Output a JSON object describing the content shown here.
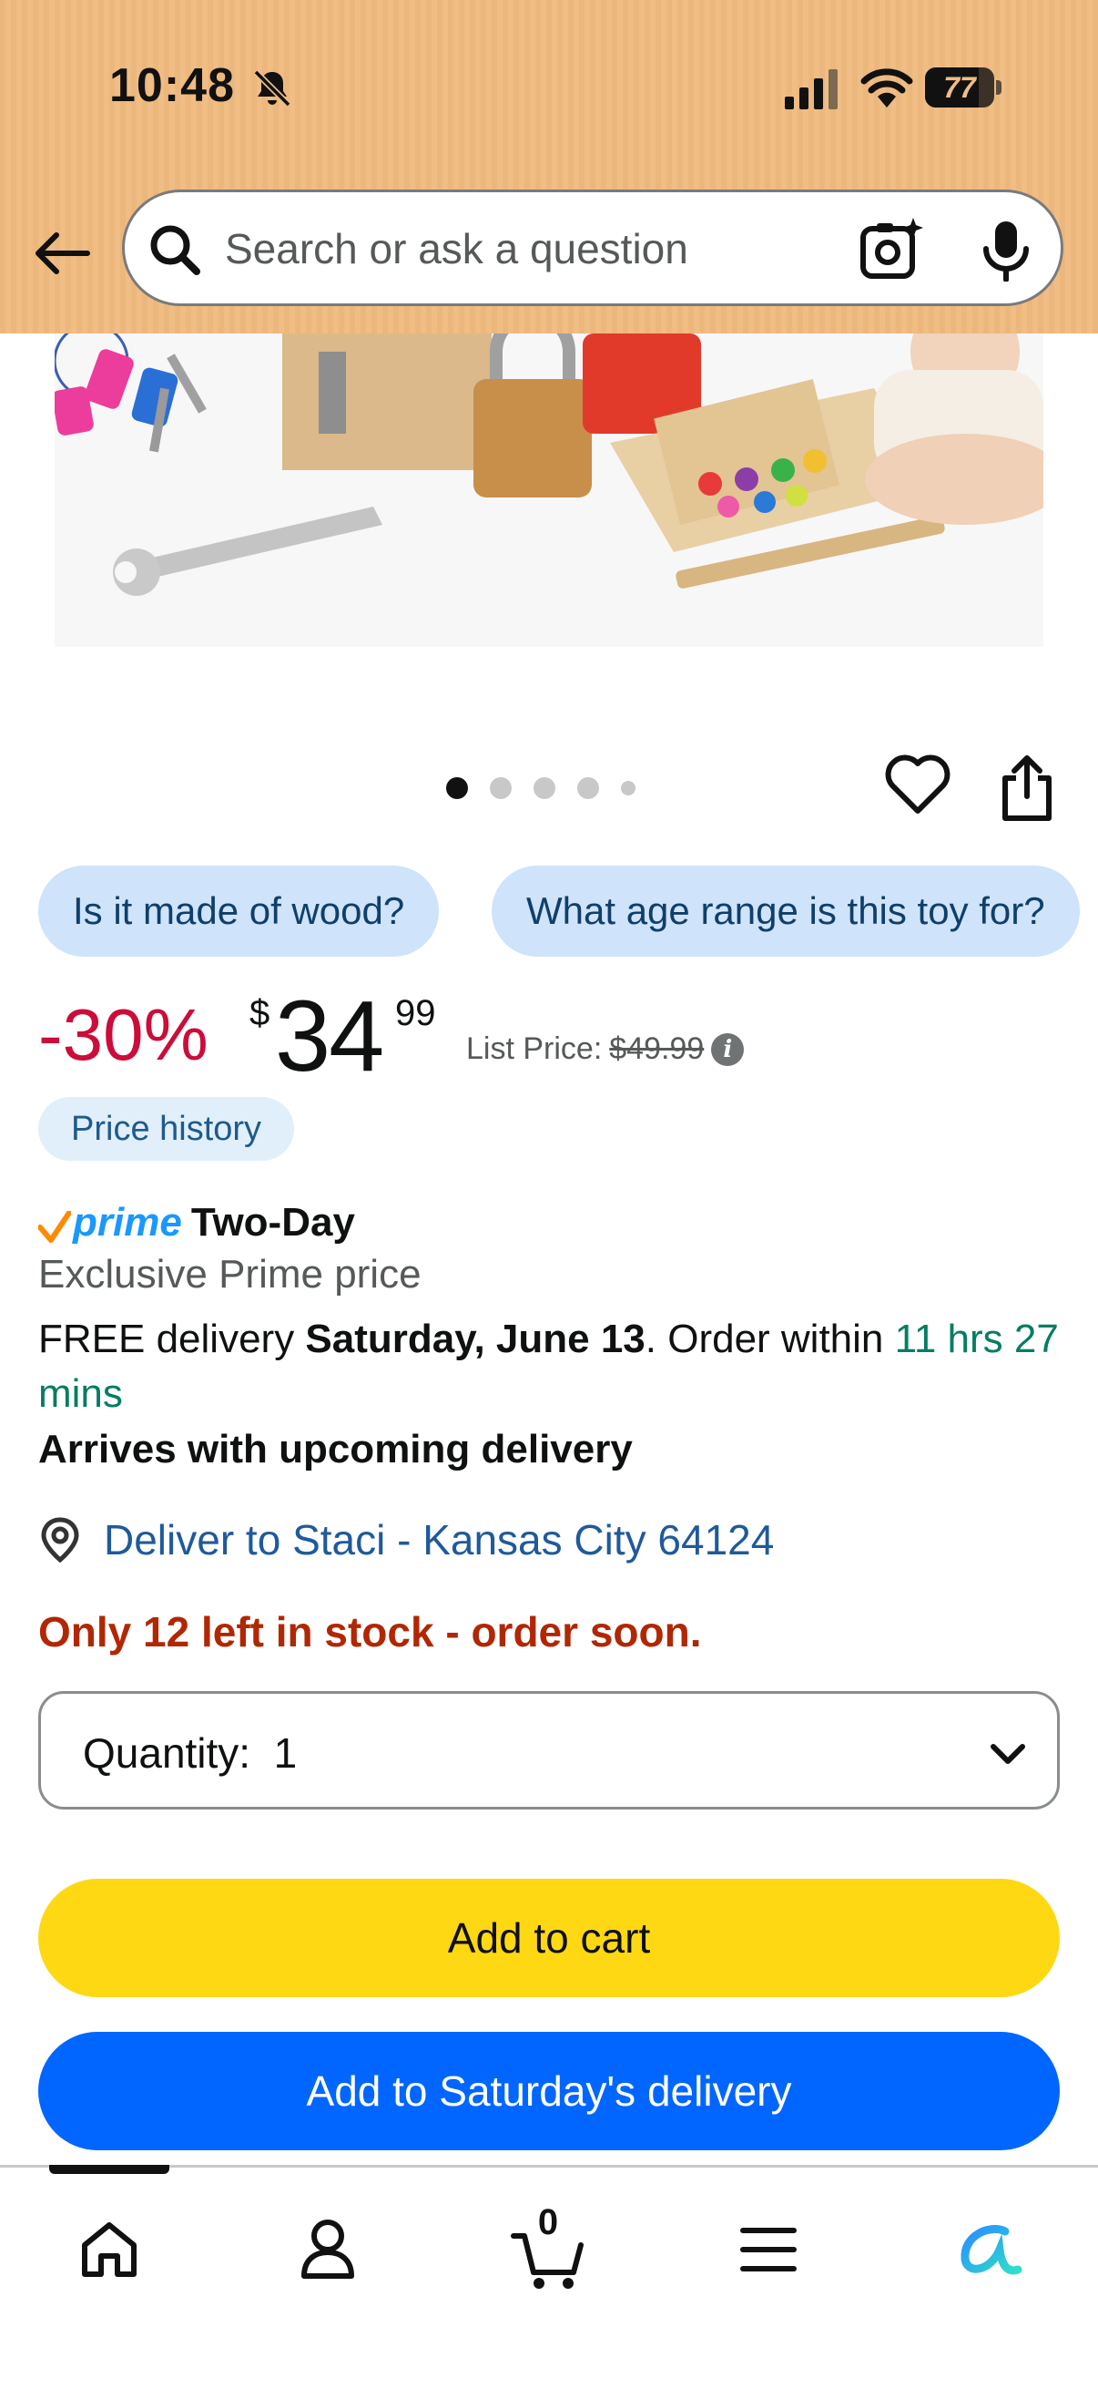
{
  "status_bar": {
    "time": "10:48",
    "battery": "77",
    "battery_level": 0.77,
    "icons": [
      "bell-slash-icon",
      "cellular-signal-icon",
      "wifi-icon",
      "battery-icon"
    ]
  },
  "header": {
    "search_placeholder": "Search or ask a question",
    "icons": [
      "back-arrow-icon",
      "search-icon",
      "camera-lens-icon",
      "microphone-icon"
    ],
    "background": "#f0bd84"
  },
  "carousel": {
    "image_count": 5,
    "active_index": 0,
    "icons": [
      "heart-icon",
      "share-icon"
    ]
  },
  "questions": [
    "Is it made of wood?",
    "What age range is this toy for?"
  ],
  "price": {
    "discount": "-30%",
    "currency": "$",
    "whole": "34",
    "fraction": "99",
    "list_price_label": "List Price:",
    "list_price": "$49.99",
    "price_history": "Price history"
  },
  "delivery": {
    "prime": "prime",
    "prime_label": "Two-Day",
    "exclusive": "Exclusive Prime price",
    "free_delivery": "FREE delivery",
    "date": "Saturday, June 13",
    "order_within": ". Order within ",
    "countdown": "11 hrs 27 mins",
    "arrives": "Arrives with upcoming delivery",
    "deliver_to": "Deliver to Staci - Kansas City 64124"
  },
  "stock": "Only 12 left in stock - order soon.",
  "quantity": {
    "label": "Quantity:",
    "value": "1"
  },
  "buttons": {
    "add_to_cart": "Add to cart",
    "add_to_saturday": "Add to Saturday's delivery"
  },
  "bottom_nav": {
    "cart_count": "0",
    "items": [
      "home-icon",
      "account-icon",
      "cart-icon",
      "menu-icon",
      "rufus-ai-icon"
    ]
  },
  "colors": {
    "discount": "#cc0c39",
    "add_to_cart": "#ffd814",
    "add_to_saturday": "#0066ff",
    "stock_warning": "#b12704",
    "link": "#1f5a9b",
    "countdown": "#067d62",
    "chip": "#cfe3fa"
  }
}
